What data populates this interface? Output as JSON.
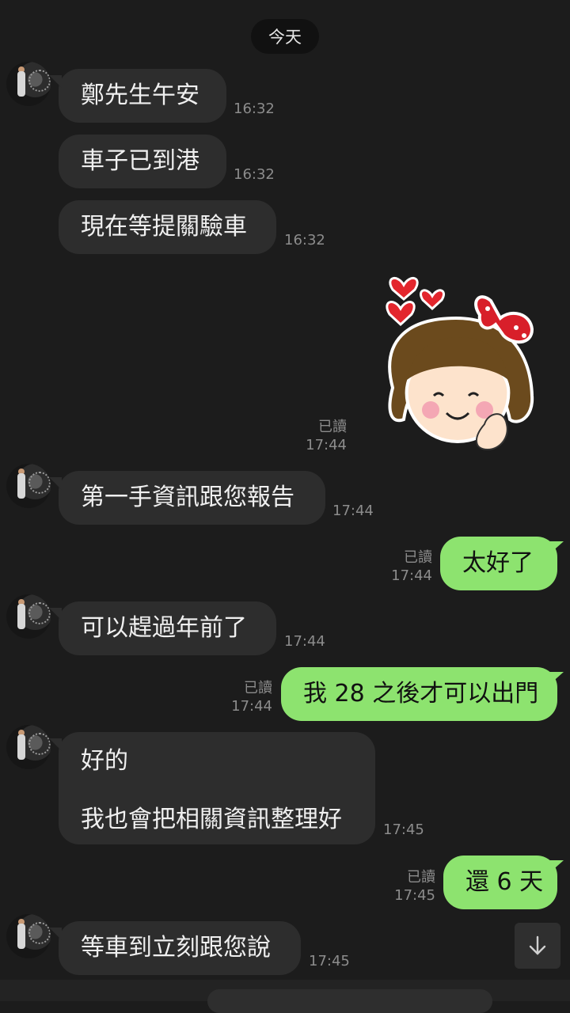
{
  "date_separator": "今天",
  "messages": {
    "m1": {
      "text": "鄭先生午安",
      "time": "16:32"
    },
    "m2": {
      "text": "車子已到港",
      "time": "16:32"
    },
    "m3": {
      "text": "現在等提關驗車",
      "time": "16:32"
    },
    "m4": {
      "read": "已讀",
      "time": "17:44"
    },
    "m5": {
      "text": "第一手資訊跟您報告",
      "time": "17:44"
    },
    "m6": {
      "text": "太好了",
      "read": "已讀",
      "time": "17:44"
    },
    "m7": {
      "text": "可以趕過年前了",
      "time": "17:44"
    },
    "m8": {
      "text": "我 28 之後才可以出門",
      "read": "已讀",
      "time": "17:44"
    },
    "m9": {
      "line1": "好的",
      "line2": "我也會把相關資訊整理好",
      "time": "17:45"
    },
    "m10": {
      "text": "還 6 天",
      "read": "已讀",
      "time": "17:45"
    },
    "m11": {
      "text": "等車到立刻跟您說",
      "time": "17:45"
    }
  },
  "sticker": {
    "icon": "girl-with-hearts-sticker"
  },
  "scroll_down": {
    "icon": "arrow-down-icon"
  },
  "colors": {
    "background": "#1c1c1c",
    "incoming": "#2d2d2d",
    "outgoing": "#8de36f",
    "meta": "#8c8c8c"
  }
}
